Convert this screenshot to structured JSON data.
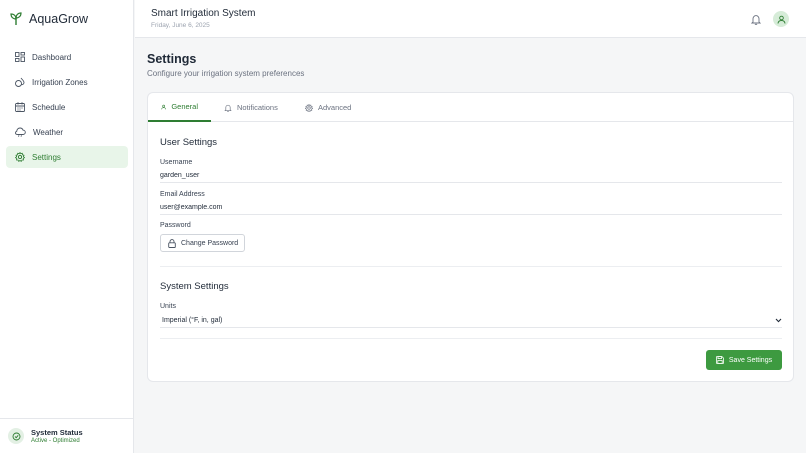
{
  "app": {
    "name": "AquaGrow"
  },
  "sidebar": {
    "items": [
      {
        "label": "Dashboard",
        "icon": "dashboard-icon"
      },
      {
        "label": "Irrigation Zones",
        "icon": "zones-icon"
      },
      {
        "label": "Schedule",
        "icon": "calendar-icon"
      },
      {
        "label": "Weather",
        "icon": "cloud-icon"
      },
      {
        "label": "Settings",
        "icon": "gear-icon",
        "active": true
      }
    ],
    "status": {
      "title": "System Status",
      "subtitle": "Active - Optimized"
    }
  },
  "header": {
    "title": "Smart Irrigation System",
    "date": "Friday, June 6, 2025"
  },
  "page": {
    "title": "Settings",
    "subtitle": "Configure your irrigation system preferences"
  },
  "tabs": [
    {
      "label": "General",
      "active": true
    },
    {
      "label": "Notifications"
    },
    {
      "label": "Advanced"
    }
  ],
  "user_settings": {
    "title": "User Settings",
    "username_label": "Username",
    "username_value": "garden_user",
    "email_label": "Email Address",
    "email_value": "user@example.com",
    "password_label": "Password",
    "change_password_label": "Change Password"
  },
  "system_settings": {
    "title": "System Settings",
    "units_label": "Units",
    "units_value": "Imperial (°F, in, gal)"
  },
  "actions": {
    "save_label": "Save Settings"
  },
  "colors": {
    "accent": "#2e7d32",
    "button": "#3d9a40",
    "active_bg": "#e8f5e9"
  }
}
